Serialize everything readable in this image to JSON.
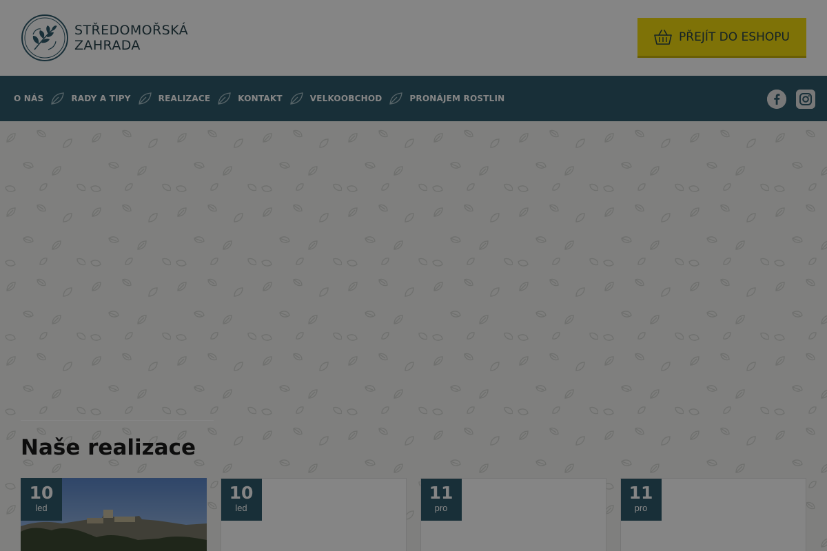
{
  "header": {
    "logo_line1": "STŘEDOMOŘSKÁ",
    "logo_line2": "ZAHRADA",
    "eshop_label": "PŘEJÍT DO ESHOPU",
    "eshop_icon": "basket-icon"
  },
  "nav": {
    "items": [
      {
        "label": "O NÁS"
      },
      {
        "label": "RADY A TIPY"
      },
      {
        "label": "REALIZACE"
      },
      {
        "label": "KONTAKT"
      },
      {
        "label": "VELKOOBCHOD"
      },
      {
        "label": "PRONÁJEM ROSTLIN"
      }
    ],
    "separator_icon": "leaf-icon",
    "social": [
      "facebook-icon",
      "instagram-icon"
    ]
  },
  "section": {
    "title": "Naše realizace"
  },
  "cards": [
    {
      "day": "10",
      "month": "led"
    },
    {
      "day": "10",
      "month": "led"
    },
    {
      "day": "11",
      "month": "pro"
    },
    {
      "day": "11",
      "month": "pro"
    }
  ],
  "colors": {
    "primary": "#2f5b6b",
    "accent": "#f1db0e",
    "text_dark": "#27424b",
    "overlay": "rgba(0,0,0,0.48)"
  }
}
